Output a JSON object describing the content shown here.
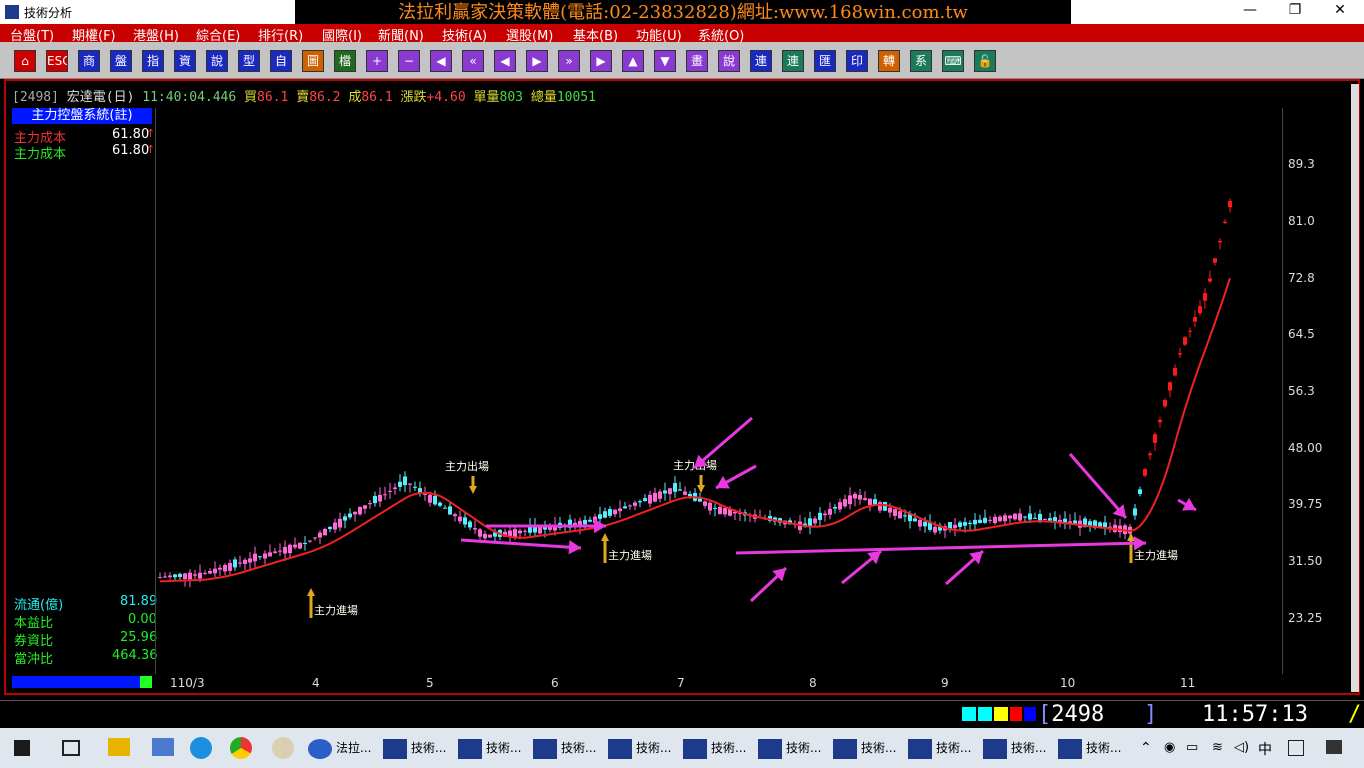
{
  "window": {
    "title": "技術分析",
    "minimize": "—",
    "restore": "❐",
    "close": "✕"
  },
  "banner": "法拉利贏家決策軟體(電話:02-23832828)網址:www.168win.com.tw",
  "menu": [
    "台盤(T)",
    "期權(F)",
    "港盤(H)",
    "綜合(E)",
    "排行(R)",
    "國際(I)",
    "新聞(N)",
    "技術(A)",
    "選股(M)",
    "基本(B)",
    "功能(U)",
    "系統(O)"
  ],
  "toolbar": [
    {
      "label": "⌂",
      "color": "#c00"
    },
    {
      "label": "ESC",
      "color": "#c00"
    },
    {
      "label": "商",
      "color": "#1a2ac0"
    },
    {
      "label": "盤",
      "color": "#1a2ac0"
    },
    {
      "label": "指",
      "color": "#1a2ac0"
    },
    {
      "label": "資",
      "color": "#1a2ac0"
    },
    {
      "label": "說",
      "color": "#1a2ac0"
    },
    {
      "label": "型",
      "color": "#1a2ac0"
    },
    {
      "label": "自",
      "color": "#1a2ac0"
    },
    {
      "label": "圖",
      "color": "#d06000"
    },
    {
      "label": "檔",
      "color": "#1f6a1f"
    },
    {
      "label": "+",
      "color": "#8a3ad0"
    },
    {
      "label": "−",
      "color": "#8a3ad0"
    },
    {
      "label": "◀",
      "color": "#8a3ad0"
    },
    {
      "label": "«",
      "color": "#8a3ad0"
    },
    {
      "label": "◀",
      "color": "#8a3ad0"
    },
    {
      "label": "▶",
      "color": "#8a3ad0"
    },
    {
      "label": "»",
      "color": "#8a3ad0"
    },
    {
      "label": "▶",
      "color": "#8a3ad0"
    },
    {
      "label": "▲",
      "color": "#8a3ad0"
    },
    {
      "label": "▼",
      "color": "#8a3ad0"
    },
    {
      "label": "畫",
      "color": "#8a3ad0"
    },
    {
      "label": "說",
      "color": "#8a3ad0"
    },
    {
      "label": "連",
      "color": "#1a2ac0"
    },
    {
      "label": "連",
      "color": "#1a7a5a"
    },
    {
      "label": "匯",
      "color": "#1a2ac0"
    },
    {
      "label": "印",
      "color": "#1a2ac0"
    },
    {
      "label": "轉",
      "color": "#d06000"
    },
    {
      "label": "系",
      "color": "#1a7a5a"
    },
    {
      "label": "⌨",
      "color": "#1a7a5a"
    },
    {
      "label": "🔓",
      "color": "#1a7a5a"
    }
  ],
  "quote": {
    "code": "[2498]",
    "name": "宏達電(日)",
    "time": "11:40:04.446",
    "buy_label": "買",
    "buy": "86.1",
    "sell_label": "賣",
    "sell": "86.2",
    "deal_label": "成",
    "deal": "86.1",
    "change_label": "漲跌",
    "change": "+4.60",
    "vol_label": "單量",
    "vol": "803",
    "total_label": "總量",
    "total": "10051"
  },
  "panel": {
    "title": "主力控盤系統(註)",
    "rows": [
      {
        "label": "主力成本",
        "value": "61.80",
        "arrow": "↑",
        "color": "#e33"
      },
      {
        "label": "主力成本",
        "value": "61.80",
        "arrow": "↑",
        "color": "#2e2"
      }
    ],
    "stats": [
      {
        "label": "流通(億)",
        "value": "81.89"
      },
      {
        "label": "本益比",
        "value": "0.00"
      },
      {
        "label": "券資比",
        "value": "25.96"
      },
      {
        "label": "當沖比",
        "value": "464.36"
      }
    ]
  },
  "chart_data": {
    "type": "candlestick",
    "y_ticks": [
      "89.3",
      "81.0",
      "72.8",
      "64.5",
      "56.3",
      "48.00",
      "39.75",
      "31.50",
      "23.25"
    ],
    "x_ticks": [
      "110/3",
      "4",
      "5",
      "6",
      "7",
      "8",
      "9",
      "10",
      "11"
    ],
    "annotations": [
      {
        "text": "主力進場"
      },
      {
        "text": "主力出場"
      },
      {
        "text": "主力進場"
      },
      {
        "text": "主力出場"
      },
      {
        "text": "主力進場"
      }
    ]
  },
  "status": {
    "code": "2498",
    "clock": "11:57:13",
    "slash": "/"
  },
  "taskbar": [
    {
      "label": "法拉..."
    },
    {
      "label": "技術..."
    },
    {
      "label": "技術..."
    },
    {
      "label": "技術..."
    },
    {
      "label": "技術..."
    },
    {
      "label": "技術..."
    },
    {
      "label": "技術..."
    },
    {
      "label": "技術..."
    },
    {
      "label": "技術..."
    },
    {
      "label": "技術..."
    },
    {
      "label": "技術..."
    }
  ],
  "tray": {
    "ime": "中"
  }
}
